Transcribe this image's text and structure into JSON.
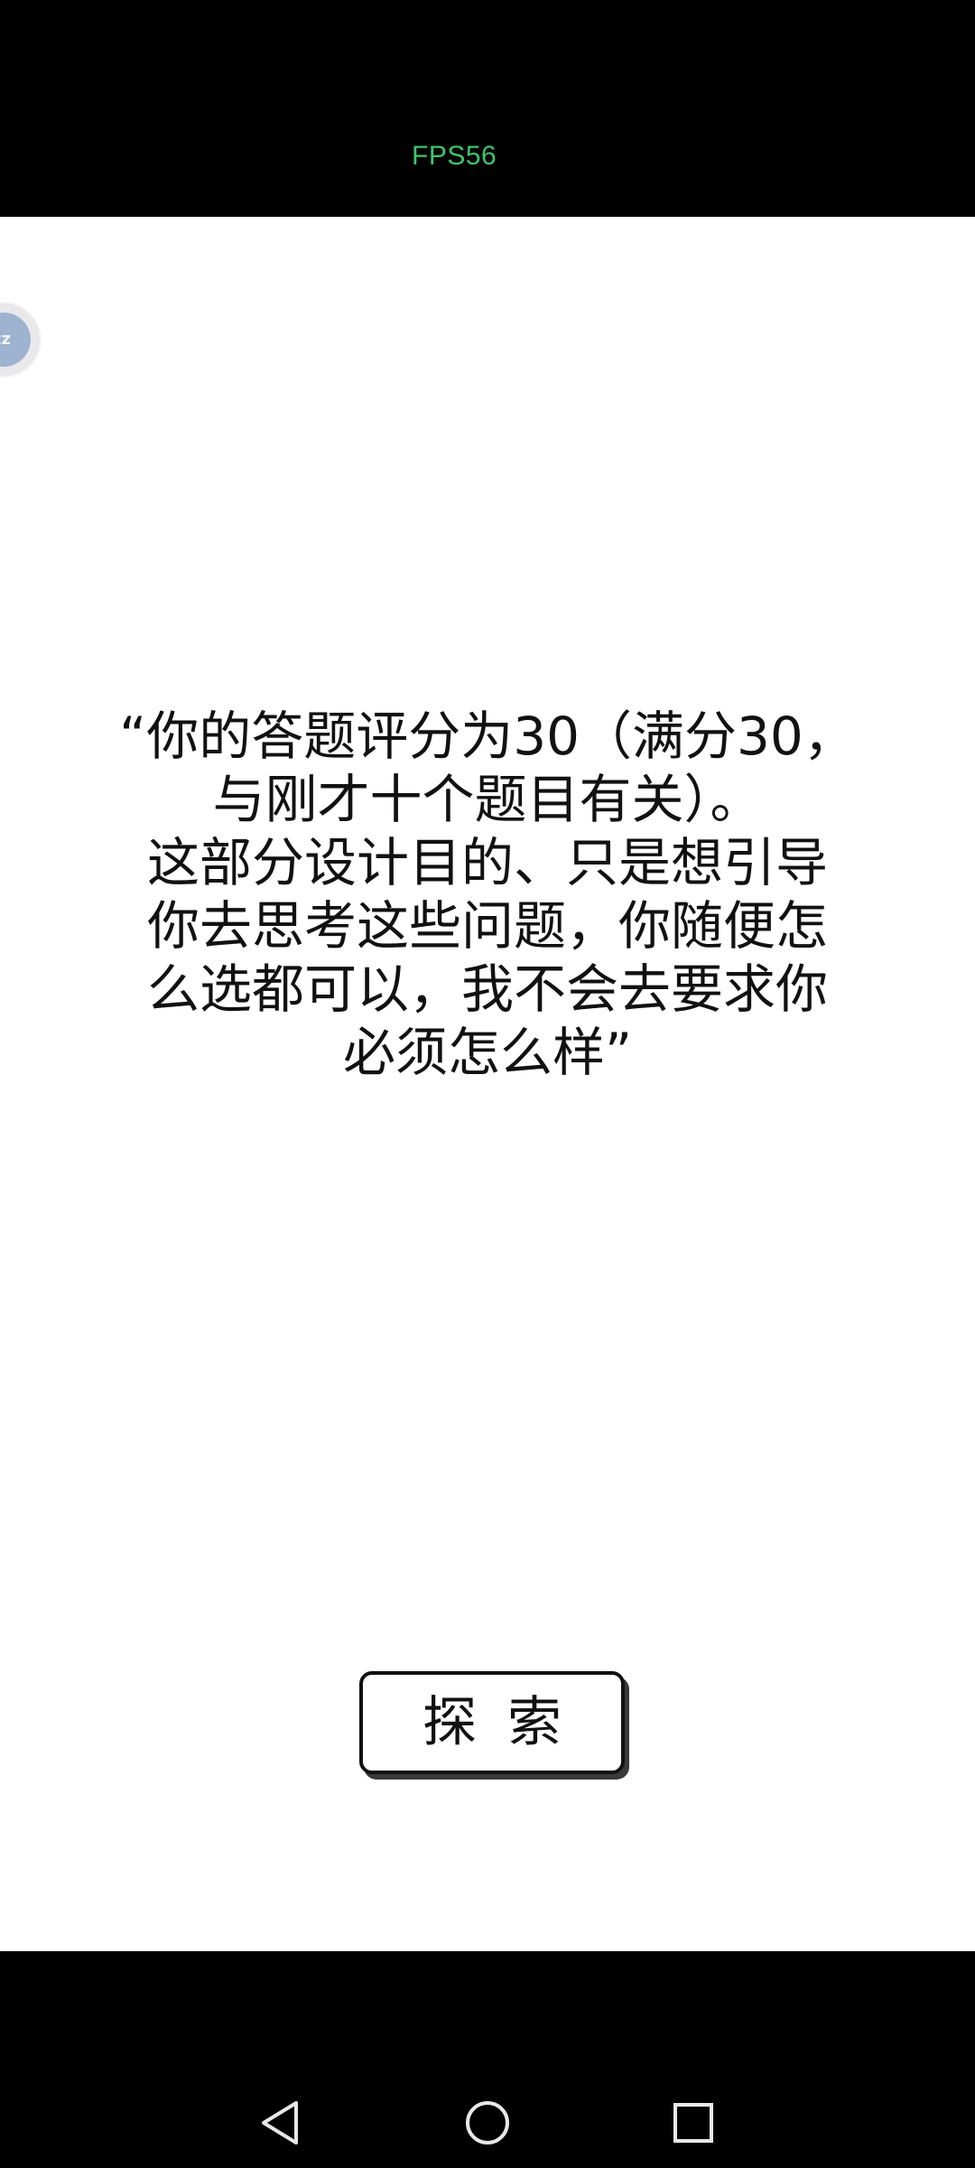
{
  "status": {
    "fps_label": "FPS56"
  },
  "game": {
    "float_ball_text": "zz",
    "dialog_text": "“你的答题评分为30（满分30，\n与刚才十个题目有关）。\n这部分设计目的、只是想引导\n你去思考这些问题，你随便怎\n么选都可以，我不会去要求你\n必须怎么样”",
    "explore_button_label": "探索"
  },
  "navigation": {
    "icons": [
      "back-icon",
      "home-icon",
      "recent-apps-icon"
    ]
  },
  "colors": {
    "fps_text": "#3ec46d",
    "background": "#ffffff",
    "bars": "#000000"
  }
}
